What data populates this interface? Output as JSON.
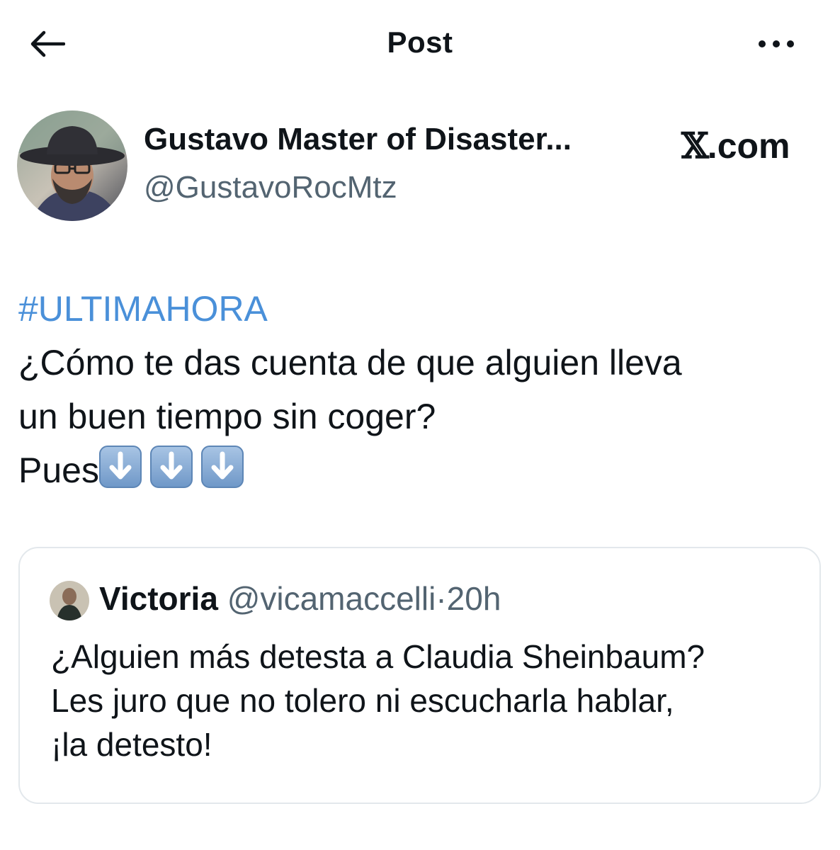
{
  "header": {
    "title": "Post",
    "back_icon": "arrow-left-icon",
    "more_icon": "more-horizontal-icon"
  },
  "author": {
    "name": "Gustavo Master of Disaster...",
    "handle": "@GustavoRocMtz",
    "avatar_icon": "profile-photo"
  },
  "watermark": {
    "logo": "𝕏",
    "text": ".com"
  },
  "post": {
    "hashtag": "#ULTIMAHORA",
    "lines": [
      "¿Cómo te das cuenta de que alguien lleva",
      "un buen tiempo sin coger?"
    ],
    "last_line_text": "Pues",
    "emoji_icons": [
      "down-arrow-emoji",
      "down-arrow-emoji",
      "down-arrow-emoji"
    ]
  },
  "quote": {
    "name": "Victoria",
    "handle": "@vicamaccelli",
    "separator": "·",
    "time": "20h",
    "lines": [
      "¿Alguien más detesta a Claudia Sheinbaum?",
      "Les juro que no tolero ni escucharla hablar,",
      "¡la detesto!"
    ]
  },
  "colors": {
    "hashtag": "#4a90d9",
    "secondary_text": "#536471",
    "primary_text": "#0f1419",
    "card_border": "#e3e8ec"
  }
}
